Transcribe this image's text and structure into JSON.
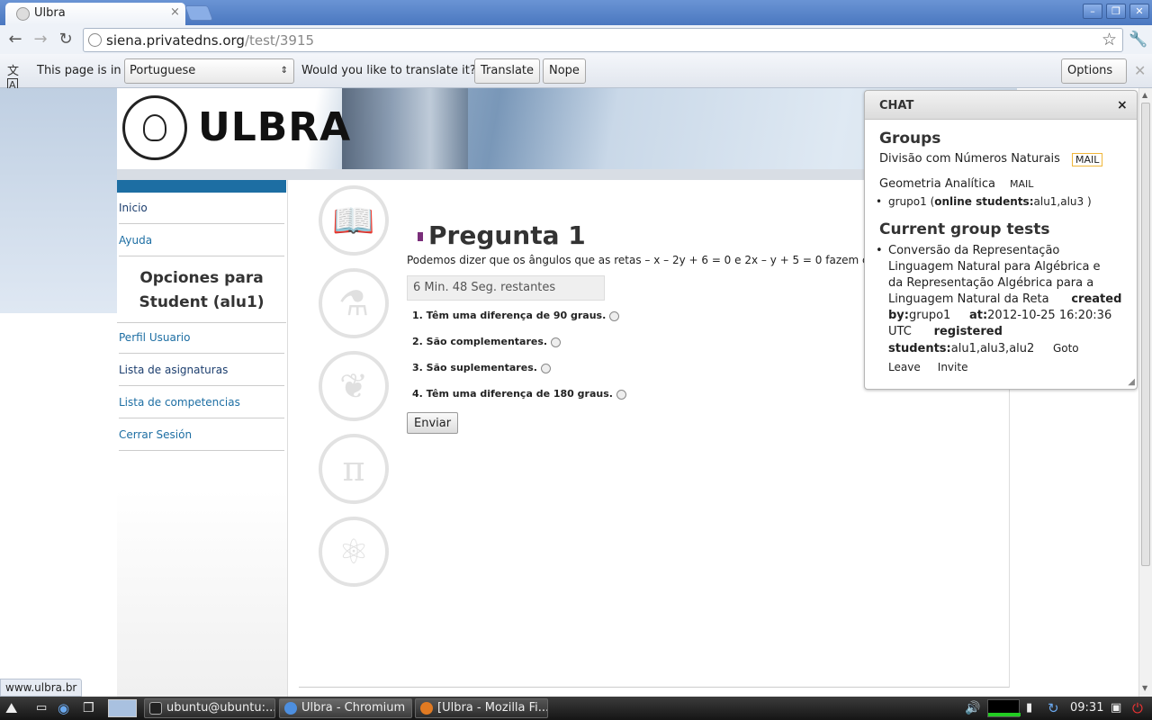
{
  "browser": {
    "tab_title": "Ulbra",
    "tab_close": "×",
    "url_host": "siena.privatedns.org",
    "url_path": "/test/3915"
  },
  "translate_bar": {
    "prefix": "This page is in",
    "language": "Portuguese",
    "question": "Would you like to translate it?",
    "translate_label": "Translate",
    "nope_label": "Nope",
    "options_label": "Options",
    "close": "✕"
  },
  "banner": {
    "logo_text": "ULBRA"
  },
  "sidebar": {
    "items": [
      {
        "label": "Inicio"
      },
      {
        "label": "Ayuda"
      },
      {
        "label": "Perfil Usuario"
      },
      {
        "label": "Lista de asignaturas"
      },
      {
        "label": "Lista de competencias"
      },
      {
        "label": "Cerrar Sesión"
      }
    ],
    "header": "Opciones para Student (alu1)"
  },
  "question": {
    "title": "Pregunta 1",
    "text": "Podemos dizer que os ângulos que as retas – x – 2y + 6 = 0 e 2x – y + 5 = 0 fazem com o eixo",
    "timer": "6 Min. 48 Seg. restantes",
    "options": [
      "1.  Têm uma diferença de 90 graus.",
      "2.  São complementares.",
      "3.  São suplementares.",
      "4.  Têm uma diferença de 180 graus."
    ],
    "submit_label": "Enviar"
  },
  "chat": {
    "title": "CHAT",
    "close": "×",
    "groups_heading": "Groups",
    "groups": [
      {
        "name": "Divisão com Números Naturais",
        "mail": "MAIL"
      },
      {
        "name": "Geometria Analítica",
        "mail": "MAIL"
      }
    ],
    "subgroup_name": "grupo1",
    "online_label": "online students:",
    "online_value": "alu1,alu3",
    "tests_heading": "Current group tests",
    "test": {
      "name_line1": "Conversão da Representação",
      "name_line2": "Linguagem Natural para Algébrica e",
      "name_line3": "da Representação Algébrica para a",
      "name_line4": "Linguagem Natural da Reta",
      "created_label": "created",
      "by_label": "by:",
      "by_value": "grupo1",
      "at_label": "at:",
      "at_value": "2012-10-25 16:20:36",
      "utc": "UTC",
      "registered_label": "registered",
      "students_label": "students:",
      "students_value": "alu1,alu3,alu2",
      "goto": "Goto",
      "leave": "Leave",
      "invite": "Invite"
    }
  },
  "status_bar": {
    "text": "www.ulbra.br"
  },
  "taskbar": {
    "tasks": [
      {
        "label": "ubuntu@ubuntu:..."
      },
      {
        "label": "Ulbra - Chromium"
      },
      {
        "label": "[Ulbra - Mozilla Fi..."
      }
    ],
    "clock": "09:31"
  },
  "colors": {
    "link": "#1d6ea3",
    "sidebar_bar": "#1d6ea3",
    "title_bullet": "#7a2e7a",
    "mail_border": "#f0b63a"
  }
}
